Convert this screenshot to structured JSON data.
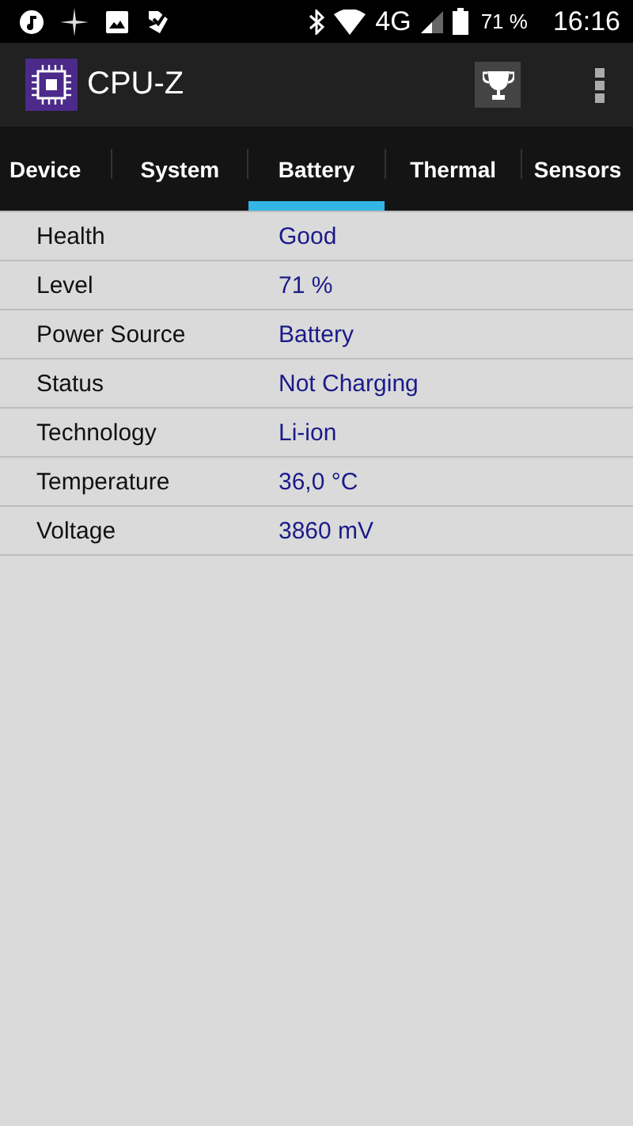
{
  "status_bar": {
    "network": "4G",
    "battery": "71 %",
    "time": "16:16"
  },
  "app_bar": {
    "title": "CPU-Z"
  },
  "tabs": [
    {
      "label": "Device",
      "selected": false
    },
    {
      "label": "System",
      "selected": false
    },
    {
      "label": "Battery",
      "selected": true
    },
    {
      "label": "Thermal",
      "selected": false
    },
    {
      "label": "Sensors",
      "selected": false
    }
  ],
  "rows": [
    {
      "label": "Health",
      "value": "Good"
    },
    {
      "label": "Level",
      "value": "71 %"
    },
    {
      "label": "Power Source",
      "value": "Battery"
    },
    {
      "label": "Status",
      "value": "Not Charging"
    },
    {
      "label": "Technology",
      "value": "Li-ion"
    },
    {
      "label": "Temperature",
      "value": "36,0 °C"
    },
    {
      "label": "Voltage",
      "value": "3860 mV"
    }
  ]
}
